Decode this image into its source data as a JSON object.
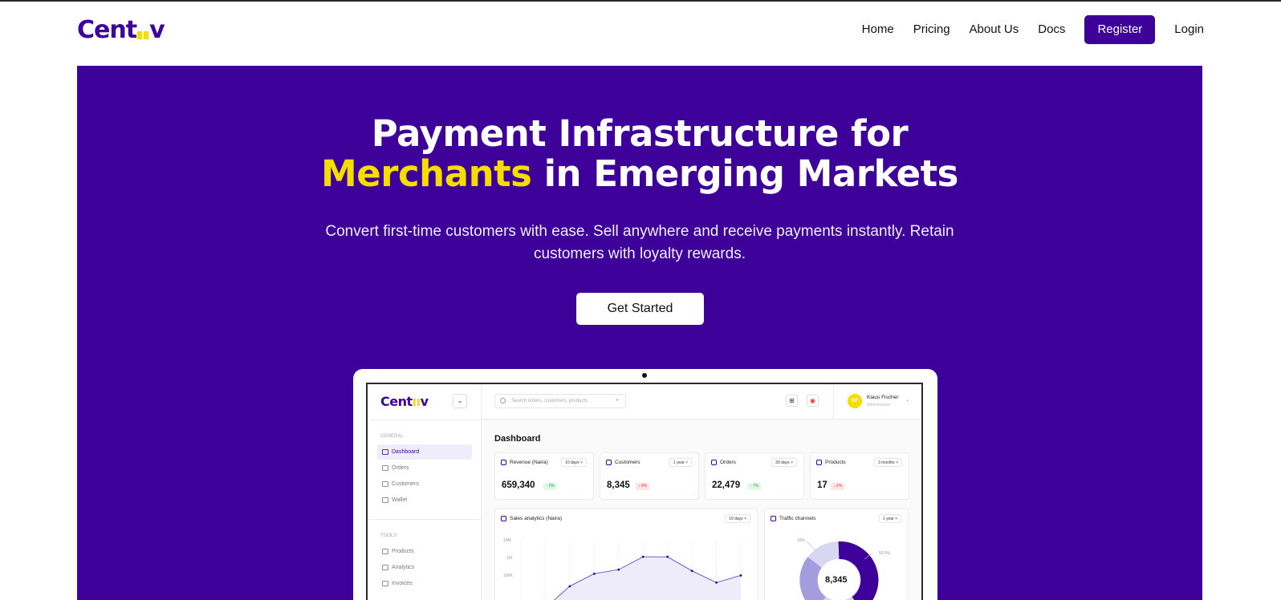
{
  "nav": {
    "logo": "Cent",
    "logo_tail": "v",
    "links": [
      "Home",
      "Pricing",
      "About Us",
      "Docs"
    ],
    "register": "Register",
    "login": "Login"
  },
  "hero": {
    "title_line1": "Payment Infrastructure for",
    "title_highlight": "Merchants",
    "title_line2": "in Emerging Markets",
    "subtitle_line1": "Convert first-time customers with ease. Sell anywhere and receive payments instantly. Retain",
    "subtitle_line2": "customers with loyalty rewards.",
    "cta": "Get Started"
  },
  "colors": {
    "brand": "#3d0099",
    "accent": "#f5dd00",
    "hero_bg": "#3d0099"
  },
  "dashboard": {
    "logo": "Cent",
    "logo_tail": "v",
    "search_placeholder": "Search orders, customers, products",
    "user": {
      "initials": "KF",
      "name": "Klaus Fischer",
      "role": "Administrator"
    },
    "groups": {
      "general": "GENERAL",
      "tools": "TOOLS"
    },
    "general_items": [
      "Dashboard",
      "Orders",
      "Customers",
      "Wallet"
    ],
    "tools_items": [
      "Products",
      "Analytics",
      "Invoices"
    ],
    "title": "Dashboard",
    "stats": [
      {
        "title": "Revenue (Naira)",
        "period": "10 days ˅",
        "value": "659,340",
        "change": "↑ 8%",
        "trend": "up"
      },
      {
        "title": "Customers",
        "period": "1 year ˅",
        "value": "8,345",
        "change": "↓ 9%",
        "trend": "down"
      },
      {
        "title": "Orders",
        "period": "30 days ˅",
        "value": "22,479",
        "change": "↑ 7%",
        "trend": "up"
      },
      {
        "title": "Products",
        "period": "3 months ˅",
        "value": "17",
        "change": "↓ 2%",
        "trend": "down"
      }
    ],
    "sales": {
      "title": "Sales analytics (Naira)",
      "period": "10 days ˅",
      "y_ticks": [
        "10M",
        "1M",
        "100K"
      ]
    },
    "traffic": {
      "title": "Traffic channels",
      "period": "1 year ˅",
      "total": "8,345",
      "label_a": "10%",
      "label_b": "50.0%"
    }
  },
  "chart_data": {
    "type": "line",
    "title": "Sales analytics (Naira)",
    "y_scale": "log",
    "y_ticks": [
      "100K",
      "1M",
      "10M"
    ],
    "values": [
      40000,
      55000,
      300000,
      800000,
      1100000,
      3000000,
      3000000,
      1000000,
      400000,
      700000
    ]
  }
}
